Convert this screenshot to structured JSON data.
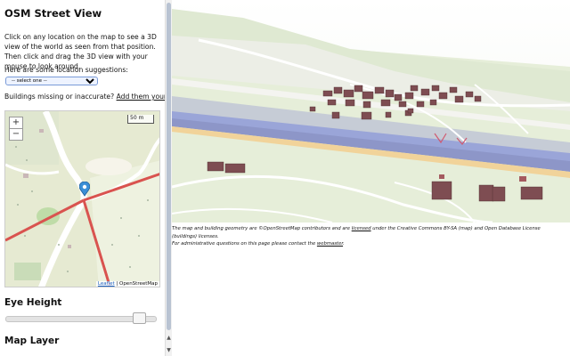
{
  "sidebar": {
    "title": "OSM Street View",
    "intro": "Click on any location on the map to see a 3D view of the world as seen from that position. Then click and drag the 3D view with your mouse to look around.",
    "suggestions_label": "Here are some location suggestions:",
    "select_value": "-- select one --",
    "missing_text": "Buildings missing or inaccurate?",
    "missing_link": "Add them yourself",
    "missing_suffix": "!",
    "eye_height_heading": "Eye Height",
    "eye_height_level": 0.9,
    "map_layer_heading": "Map Layer"
  },
  "minimap": {
    "zoom_in": "+",
    "zoom_out": "−",
    "scale": "50 m",
    "attribution_leaflet": "Leaflet",
    "attribution_sep": " | ",
    "attribution_osm": "OpenStreetMap",
    "icon": "location-marker-icon"
  },
  "footer": {
    "part1": "The map and building geometry are ©OpenStreetMap contributors and are ",
    "licensed": "licensed",
    "part2": " under the Creative Commons BY-SA (map) and Open Database License (buildings) licenses.",
    "admin": "For administrative questions on this page please contact the ",
    "webmaster": "webmaster",
    "admin_end": "."
  },
  "colors": {
    "canal": "#9aa5d8",
    "road": "#f1d39a",
    "buildings": "#7e4d52",
    "land": "#e4ead8",
    "red_road": "#d9534f"
  }
}
